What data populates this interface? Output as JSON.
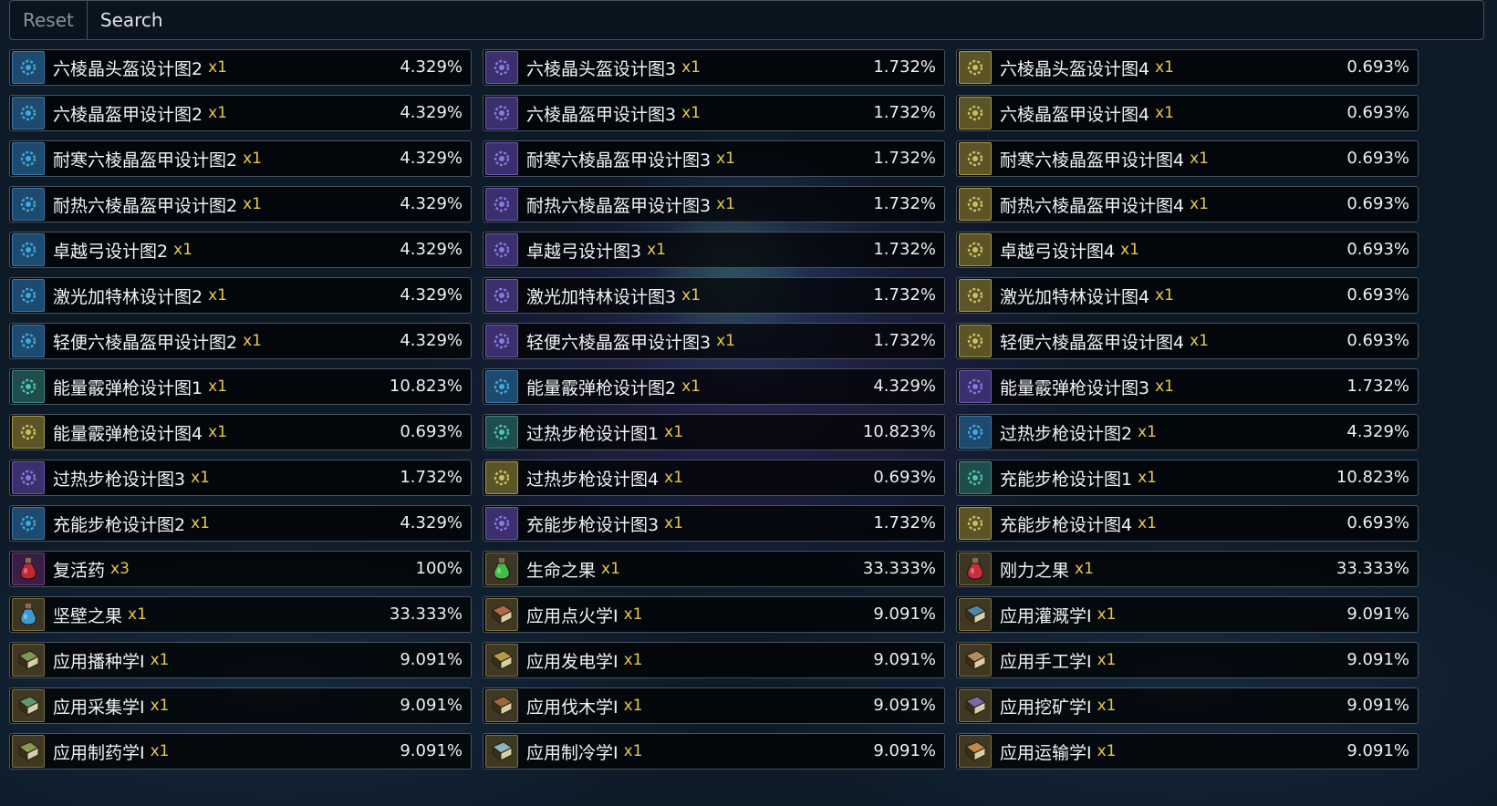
{
  "toolbar": {
    "reset_label": "Reset",
    "search_label": "Search"
  },
  "items": [
    {
      "name": "六棱晶头盔设计图2",
      "qty": "x1",
      "pct": "4.329%",
      "icon": "blueprint-icon",
      "tier": "blue"
    },
    {
      "name": "六棱晶头盔设计图3",
      "qty": "x1",
      "pct": "1.732%",
      "icon": "blueprint-icon",
      "tier": "purple"
    },
    {
      "name": "六棱晶头盔设计图4",
      "qty": "x1",
      "pct": "0.693%",
      "icon": "blueprint-icon",
      "tier": "yellow"
    },
    {
      "name": "六棱晶盔甲设计图2",
      "qty": "x1",
      "pct": "4.329%",
      "icon": "blueprint-icon",
      "tier": "blue"
    },
    {
      "name": "六棱晶盔甲设计图3",
      "qty": "x1",
      "pct": "1.732%",
      "icon": "blueprint-icon",
      "tier": "purple"
    },
    {
      "name": "六棱晶盔甲设计图4",
      "qty": "x1",
      "pct": "0.693%",
      "icon": "blueprint-icon",
      "tier": "yellow"
    },
    {
      "name": "耐寒六棱晶盔甲设计图2",
      "qty": "x1",
      "pct": "4.329%",
      "icon": "blueprint-icon",
      "tier": "blue"
    },
    {
      "name": "耐寒六棱晶盔甲设计图3",
      "qty": "x1",
      "pct": "1.732%",
      "icon": "blueprint-icon",
      "tier": "purple"
    },
    {
      "name": "耐寒六棱晶盔甲设计图4",
      "qty": "x1",
      "pct": "0.693%",
      "icon": "blueprint-icon",
      "tier": "yellow"
    },
    {
      "name": "耐热六棱晶盔甲设计图2",
      "qty": "x1",
      "pct": "4.329%",
      "icon": "blueprint-icon",
      "tier": "blue"
    },
    {
      "name": "耐热六棱晶盔甲设计图3",
      "qty": "x1",
      "pct": "1.732%",
      "icon": "blueprint-icon",
      "tier": "purple"
    },
    {
      "name": "耐热六棱晶盔甲设计图4",
      "qty": "x1",
      "pct": "0.693%",
      "icon": "blueprint-icon",
      "tier": "yellow"
    },
    {
      "name": "卓越弓设计图2",
      "qty": "x1",
      "pct": "4.329%",
      "icon": "blueprint-icon",
      "tier": "blue"
    },
    {
      "name": "卓越弓设计图3",
      "qty": "x1",
      "pct": "1.732%",
      "icon": "blueprint-icon",
      "tier": "purple"
    },
    {
      "name": "卓越弓设计图4",
      "qty": "x1",
      "pct": "0.693%",
      "icon": "blueprint-icon",
      "tier": "yellow"
    },
    {
      "name": "激光加特林设计图2",
      "qty": "x1",
      "pct": "4.329%",
      "icon": "blueprint-icon",
      "tier": "blue"
    },
    {
      "name": "激光加特林设计图3",
      "qty": "x1",
      "pct": "1.732%",
      "icon": "blueprint-icon",
      "tier": "purple"
    },
    {
      "name": "激光加特林设计图4",
      "qty": "x1",
      "pct": "0.693%",
      "icon": "blueprint-icon",
      "tier": "yellow"
    },
    {
      "name": "轻便六棱晶盔甲设计图2",
      "qty": "x1",
      "pct": "4.329%",
      "icon": "blueprint-icon",
      "tier": "blue"
    },
    {
      "name": "轻便六棱晶盔甲设计图3",
      "qty": "x1",
      "pct": "1.732%",
      "icon": "blueprint-icon",
      "tier": "purple"
    },
    {
      "name": "轻便六棱晶盔甲设计图4",
      "qty": "x1",
      "pct": "0.693%",
      "icon": "blueprint-icon",
      "tier": "yellow"
    },
    {
      "name": "能量霰弹枪设计图1",
      "qty": "x1",
      "pct": "10.823%",
      "icon": "blueprint-icon",
      "tier": "teal"
    },
    {
      "name": "能量霰弹枪设计图2",
      "qty": "x1",
      "pct": "4.329%",
      "icon": "blueprint-icon",
      "tier": "blue"
    },
    {
      "name": "能量霰弹枪设计图3",
      "qty": "x1",
      "pct": "1.732%",
      "icon": "blueprint-icon",
      "tier": "purple"
    },
    {
      "name": "能量霰弹枪设计图4",
      "qty": "x1",
      "pct": "0.693%",
      "icon": "blueprint-icon",
      "tier": "yellow"
    },
    {
      "name": "过热步枪设计图1",
      "qty": "x1",
      "pct": "10.823%",
      "icon": "blueprint-icon",
      "tier": "teal"
    },
    {
      "name": "过热步枪设计图2",
      "qty": "x1",
      "pct": "4.329%",
      "icon": "blueprint-icon",
      "tier": "blue"
    },
    {
      "name": "过热步枪设计图3",
      "qty": "x1",
      "pct": "1.732%",
      "icon": "blueprint-icon",
      "tier": "purple"
    },
    {
      "name": "过热步枪设计图4",
      "qty": "x1",
      "pct": "0.693%",
      "icon": "blueprint-icon",
      "tier": "yellow"
    },
    {
      "name": "充能步枪设计图1",
      "qty": "x1",
      "pct": "10.823%",
      "icon": "blueprint-icon",
      "tier": "teal"
    },
    {
      "name": "充能步枪设计图2",
      "qty": "x1",
      "pct": "4.329%",
      "icon": "blueprint-icon",
      "tier": "blue"
    },
    {
      "name": "充能步枪设计图3",
      "qty": "x1",
      "pct": "1.732%",
      "icon": "blueprint-icon",
      "tier": "purple"
    },
    {
      "name": "充能步枪设计图4",
      "qty": "x1",
      "pct": "0.693%",
      "icon": "blueprint-icon",
      "tier": "yellow"
    },
    {
      "name": "复活药",
      "qty": "x3",
      "pct": "100%",
      "icon": "red-potion-icon",
      "tier": "potion",
      "color": "#c0283a"
    },
    {
      "name": "生命之果",
      "qty": "x1",
      "pct": "33.333%",
      "icon": "green-fruit-icon",
      "tier": "fruit",
      "color": "#3fbf45"
    },
    {
      "name": "刚力之果",
      "qty": "x1",
      "pct": "33.333%",
      "icon": "red-fruit-icon",
      "tier": "fruit",
      "color": "#c72f3a"
    },
    {
      "name": "坚壁之果",
      "qty": "x1",
      "pct": "33.333%",
      "icon": "blue-fruit-icon",
      "tier": "fruit",
      "color": "#3a9ad0"
    },
    {
      "name": "应用点火学Ⅰ",
      "qty": "x1",
      "pct": "9.091%",
      "icon": "red-book-icon",
      "tier": "book",
      "color": "#b5674a"
    },
    {
      "name": "应用灌溉学Ⅰ",
      "qty": "x1",
      "pct": "9.091%",
      "icon": "blue-book-icon",
      "tier": "book",
      "color": "#4f86a8"
    },
    {
      "name": "应用播种学Ⅰ",
      "qty": "x1",
      "pct": "9.091%",
      "icon": "green-book-icon",
      "tier": "book",
      "color": "#7d9a55"
    },
    {
      "name": "应用发电学Ⅰ",
      "qty": "x1",
      "pct": "9.091%",
      "icon": "yellow-book-icon",
      "tier": "book",
      "color": "#b59a4c"
    },
    {
      "name": "应用手工学Ⅰ",
      "qty": "x1",
      "pct": "9.091%",
      "icon": "tan-book-icon",
      "tier": "book",
      "color": "#b58a5c"
    },
    {
      "name": "应用采集学Ⅰ",
      "qty": "x1",
      "pct": "9.091%",
      "icon": "green-book-icon",
      "tier": "book",
      "color": "#5f9a6d"
    },
    {
      "name": "应用伐木学Ⅰ",
      "qty": "x1",
      "pct": "9.091%",
      "icon": "brown-book-icon",
      "tier": "book",
      "color": "#9a6a3a"
    },
    {
      "name": "应用挖矿学Ⅰ",
      "qty": "x1",
      "pct": "9.091%",
      "icon": "purple-book-icon",
      "tier": "book",
      "color": "#7a6aa8"
    },
    {
      "name": "应用制药学Ⅰ",
      "qty": "x1",
      "pct": "9.091%",
      "icon": "olive-book-icon",
      "tier": "book",
      "color": "#8a9a4c"
    },
    {
      "name": "应用制冷学Ⅰ",
      "qty": "x1",
      "pct": "9.091%",
      "icon": "ice-book-icon",
      "tier": "book",
      "color": "#8ab4c4"
    },
    {
      "name": "应用运输学Ⅰ",
      "qty": "x1",
      "pct": "9.091%",
      "icon": "orange-book-icon",
      "tier": "book",
      "color": "#c4884c"
    }
  ]
}
